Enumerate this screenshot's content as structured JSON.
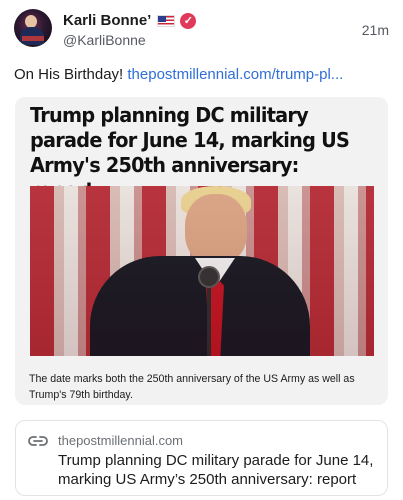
{
  "post": {
    "author_name": "Karli Bonne’",
    "author_flag": "us-flag-emoji",
    "verified_icon": "verified-badge-icon",
    "author_handle": "@KarliBonne",
    "timestamp": "21m",
    "text": "On His Birthday! ",
    "text_link": "thepostmillennial.com/trump-pl..."
  },
  "media_card": {
    "headline": "Trump planning DC military parade for June 14, marking US Army's 250th anniversary: report",
    "image_alt": "Trump speaking at a microphone in front of American flags",
    "caption": "The date marks both the 250th anniversary of the US Army as well as Trump's 79th birthday."
  },
  "link_card": {
    "icon": "link-icon",
    "domain": "thepostmillennial.com",
    "title": "Trump planning DC military parade for June 14, marking US Army’s 250th anniversary: report"
  },
  "colors": {
    "link": "#2f6fd8",
    "verified": "#e03a5a",
    "card_bg": "#f2f2f3",
    "muted": "#555a60"
  }
}
